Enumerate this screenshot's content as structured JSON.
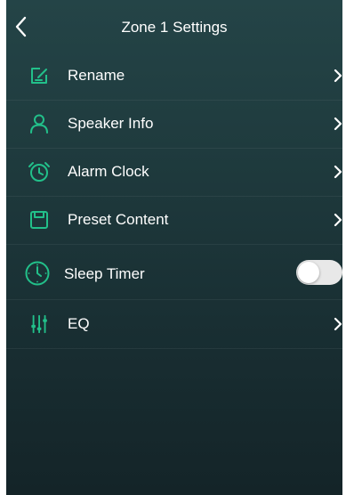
{
  "header": {
    "title": "Zone 1 Settings",
    "back_icon": "chevron-left-icon"
  },
  "colors": {
    "accent": "#22c08a",
    "background_top": "#244447",
    "background_bottom": "#142428",
    "text": "#ffffff"
  },
  "menu": [
    {
      "label": "Rename",
      "icon": "rename-icon",
      "trailing": "chevron"
    },
    {
      "label": "Speaker Info",
      "icon": "person-icon",
      "trailing": "chevron"
    },
    {
      "label": "Alarm Clock",
      "icon": "alarm-clock-icon",
      "trailing": "chevron"
    },
    {
      "label": "Preset Content",
      "icon": "preset-icon",
      "trailing": "chevron"
    },
    {
      "label": "Sleep Timer",
      "icon": "sleep-timer-icon",
      "trailing": "toggle",
      "toggle_on": false
    },
    {
      "label": "EQ",
      "icon": "eq-sliders-icon",
      "trailing": "chevron"
    }
  ]
}
